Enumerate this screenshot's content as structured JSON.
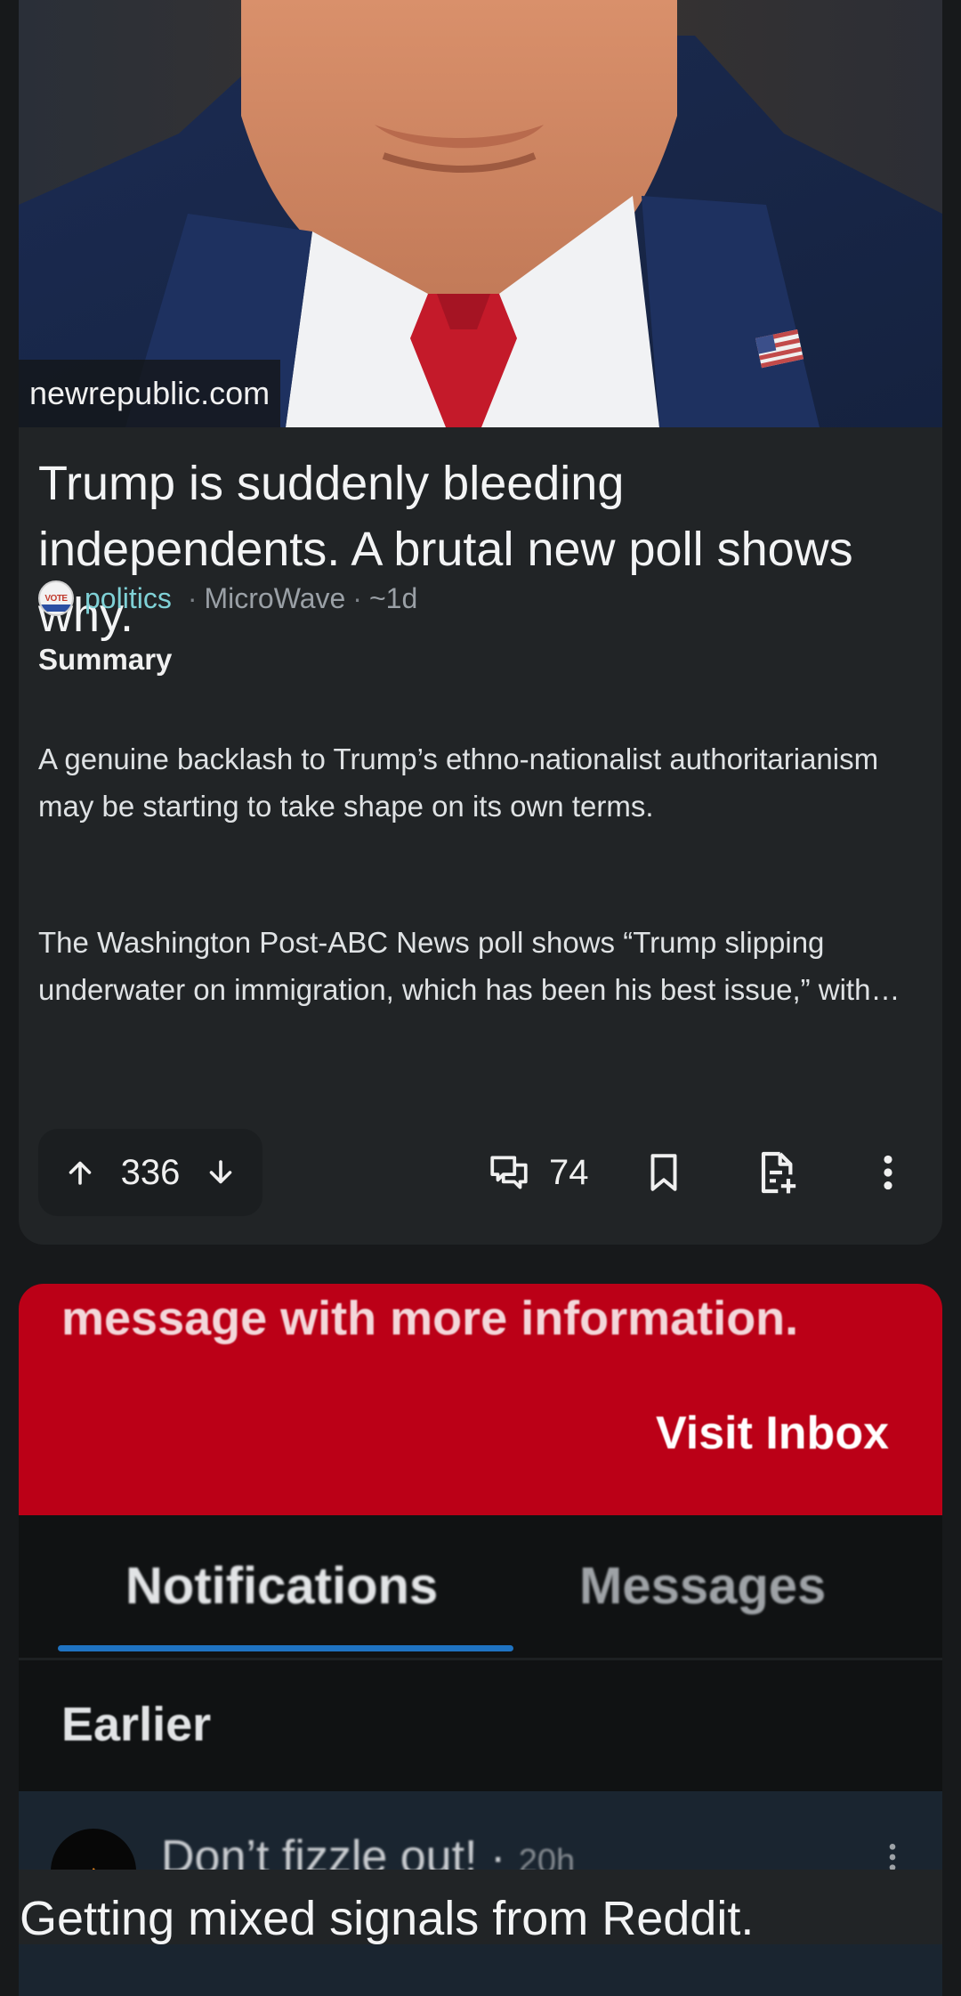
{
  "post": {
    "domain": "newrepublic.com",
    "title": "Trump is suddenly bleeding independents. A brutal new poll shows why.",
    "community_icon": "vote-badge-icon",
    "community_icon_text": "VOTE",
    "community": "politics",
    "author": "MicroWave",
    "age": "~1d",
    "summary_heading": "Summary",
    "summary_p1": "A genuine backlash to Trump’s ethno-nationalist authoritarianism may be starting to take shape on its own terms.",
    "summary_p2": "The Washington Post-ABC News poll shows “Trump slipping underwater on immigration, which has been his best issue,” with…",
    "score": "336",
    "comments": "74",
    "separator": "·"
  },
  "embedded_image": {
    "banner_text": "message with more information.",
    "visit_inbox": "Visit Inbox",
    "tab_notifications": "Notifications",
    "tab_messages": "Messages",
    "section_earlier": "Earlier",
    "notif_title": "Don’t fizzle out! ·",
    "notif_time": "20h"
  },
  "next_post": {
    "title": "Getting mixed signals from Reddit."
  },
  "colors": {
    "background": "#17191b",
    "card": "#212426",
    "community_accent": "#7fd1d6",
    "banner_red": "#bb0017",
    "tab_underline": "#1f73c2"
  }
}
